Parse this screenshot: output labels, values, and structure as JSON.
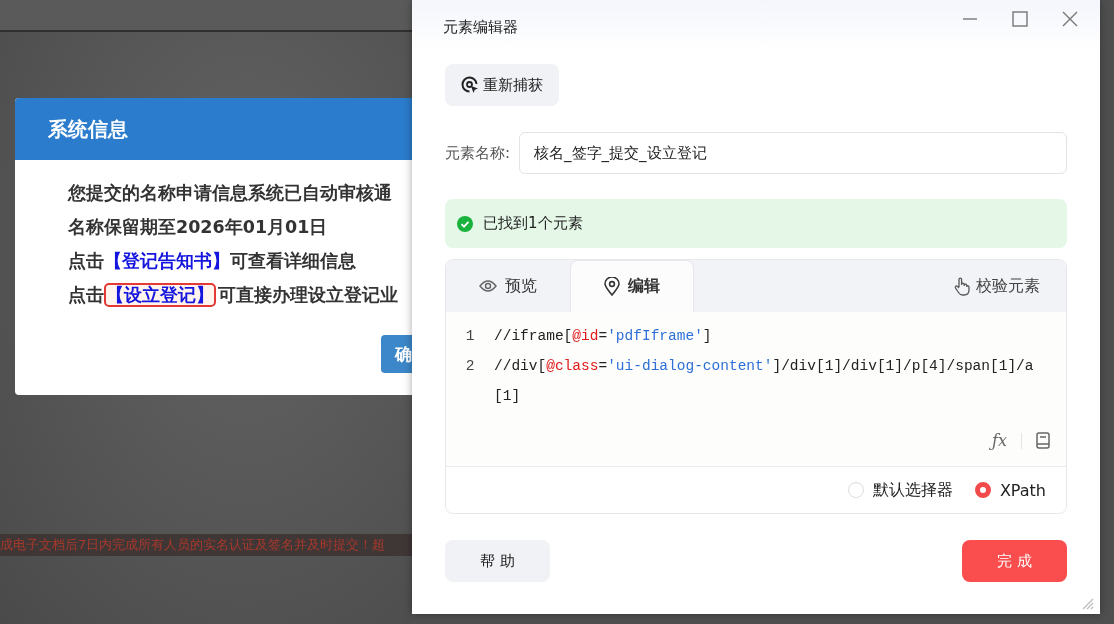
{
  "background_page": {
    "warning_line": "成电子文档后7日内完成所有人员的实名认证及签名并及时提交！超"
  },
  "system_dialog": {
    "title": "系统信息",
    "lines": [
      {
        "kind": "text",
        "text": "您提交的名称申请信息系统已自动审核通"
      },
      {
        "kind": "text",
        "text": "名称保留期至2026年01月01日"
      },
      {
        "kind": "link",
        "prefix": "点击",
        "link": "【登记告知书】",
        "suffix": "可查看详细信息",
        "highlighted": false
      },
      {
        "kind": "link",
        "prefix": "点击",
        "link": "【设立登记】",
        "suffix": "可直接办理设立登记业",
        "highlighted": true
      }
    ],
    "confirm_button": "确"
  },
  "editor_window": {
    "title": "元素编辑器",
    "recapture_button": "重新捕获",
    "name_field": {
      "label": "元素名称:",
      "value": "核名_签字_提交_设立登记"
    },
    "status": "已找到1个元素",
    "tabs": [
      {
        "label": "预览",
        "kind": "preview",
        "selected": false
      },
      {
        "label": "编辑",
        "kind": "edit",
        "selected": true
      }
    ],
    "verify_button": "校验元素",
    "code_lines": [
      {
        "number": "1",
        "tokens": [
          {
            "kind": "plain",
            "text": "//iframe["
          },
          {
            "kind": "attr",
            "text": "@id"
          },
          {
            "kind": "plain",
            "text": "="
          },
          {
            "kind": "string",
            "text": "'pdfIframe'"
          },
          {
            "kind": "plain",
            "text": "]"
          }
        ]
      },
      {
        "number": "2",
        "tokens": [
          {
            "kind": "plain",
            "text": "//div["
          },
          {
            "kind": "attr",
            "text": "@class"
          },
          {
            "kind": "plain",
            "text": "="
          },
          {
            "kind": "string",
            "text": "'ui-dialog-content'"
          },
          {
            "kind": "plain",
            "text": "]/div[1]/div[1]/p[4]/span[1]/a[1]"
          }
        ]
      }
    ],
    "formula_button": "ƒx",
    "selector_options": [
      {
        "label": "默认选择器",
        "selected": false
      },
      {
        "label": "XPath",
        "selected": true
      }
    ],
    "help_button": "帮 助",
    "done_button": "完 成"
  }
}
